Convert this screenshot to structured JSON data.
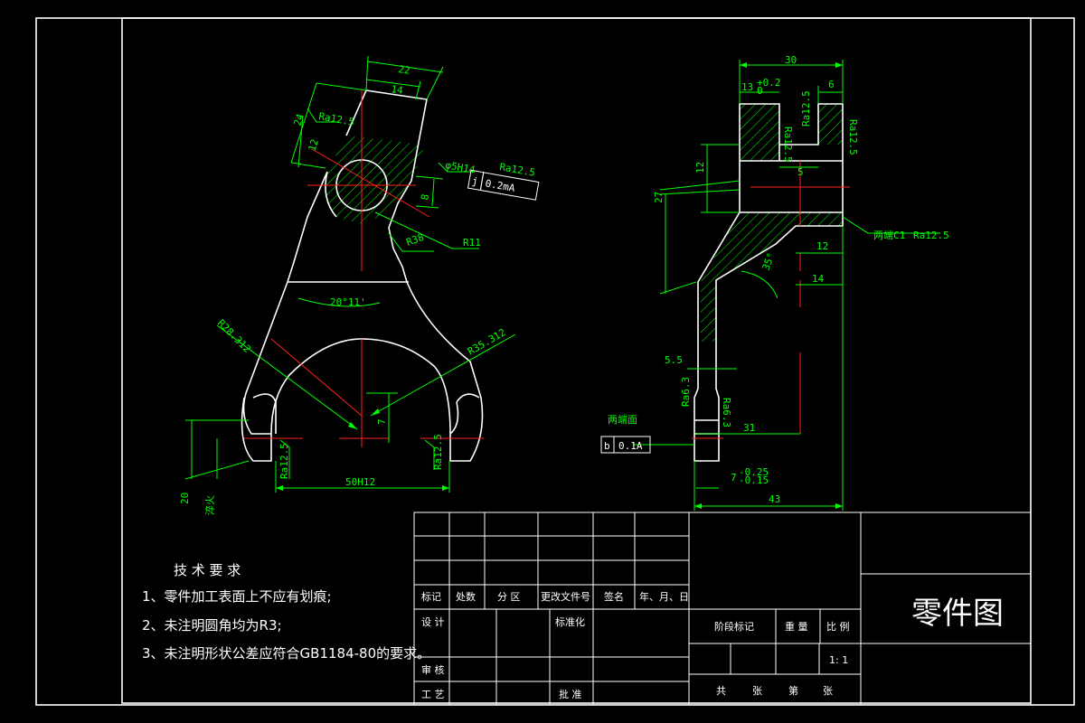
{
  "front_view": {
    "dims": {
      "d22": "22",
      "d14": "14",
      "d24": "24",
      "d12": "12",
      "d8": "8",
      "d7": "7",
      "d20": "20",
      "hole": "φ5H14",
      "r38": "R38",
      "r11": "R11",
      "angle": "20°11'",
      "r28": "R28.312",
      "r35": "R35.312",
      "width50": "50H12"
    },
    "roughness": {
      "top": "Ra12.5",
      "hole": "Ra12.5",
      "left": "Ra12.5",
      "right": "Ra12.5"
    },
    "tolerance_frame": {
      "symbol": "j",
      "value": "0.2mA"
    },
    "quench": "淬火"
  },
  "side_view": {
    "dims": {
      "d30": "30",
      "d13": "13",
      "tol13_up": "+0.2",
      "tol13_low": "0",
      "d6": "6",
      "d12": "12",
      "d27": "27",
      "d5": "5",
      "d12b": "12",
      "d14": "14",
      "angle35": "35°",
      "d5_5": "5.5",
      "d31": "31",
      "d7": "7",
      "tol7_up": "-0.25",
      "tol7_low": "-0.15",
      "d43": "43"
    },
    "roughness": {
      "slot_left": "Ra12.5",
      "slot_right": "Ra12.5",
      "slot_outer": "Ra12.5",
      "chamfer": "Ra12.5",
      "tip_left": "Ra6.3",
      "tip_right": "Ra6.3"
    },
    "chamfer_note": "两端C1",
    "datum_note": "两端面",
    "flatness": {
      "symbol": "b",
      "value": "0.1A"
    }
  },
  "requirements": {
    "title": "技 术 要 求",
    "items": [
      "1、零件加工表面上不应有划痕;",
      "2、未注明圆角均为R3;",
      "3、未注明形状公差应符合GB1184-80的要求。"
    ]
  },
  "title_block": {
    "headers": [
      "标记",
      "处数",
      "分 区",
      "更改文件号",
      "签名",
      "年、月、日"
    ],
    "design": "设 计",
    "standard": "标准化",
    "review": "审 核",
    "process": "工 艺",
    "approve": "批 准",
    "stage": "阶段标记",
    "weight": "重 量",
    "scale_label": "比 例",
    "scale_value": "1: 1",
    "sheets_total": "共",
    "sheets_zhang1": "张",
    "sheets_di": "第",
    "sheets_zhang2": "张",
    "drawing_name": "零件图"
  }
}
